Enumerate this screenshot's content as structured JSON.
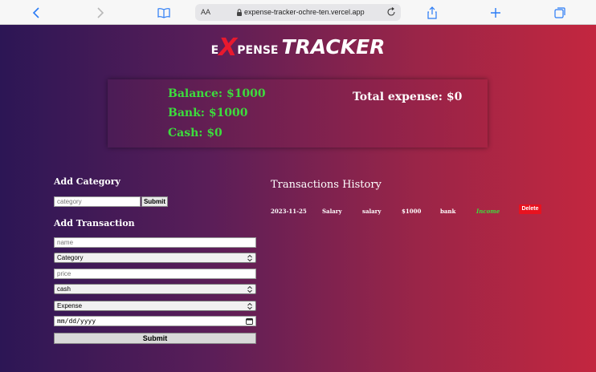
{
  "browser": {
    "text_size_label": "AA",
    "url": "expense-tracker-ochre-ten.vercel.app"
  },
  "title": {
    "first_letter": "E",
    "x_letter": "X",
    "rest": "PENSE",
    "tracker": "TRACKER"
  },
  "summary": {
    "balance": "Balance: $1000",
    "bank": "Bank: $1000",
    "cash": "Cash: $0",
    "total_expense": "Total expense: $0"
  },
  "add_category": {
    "heading": "Add Category",
    "placeholder": "category",
    "submit_label": "Submit"
  },
  "add_transaction": {
    "heading": "Add Transaction",
    "name_placeholder": "name",
    "category_selected": "Category",
    "price_placeholder": "price",
    "mode_selected": "cash",
    "type_selected": "Expense",
    "date_placeholder": "mm/dd/yyyy",
    "submit_label": "Submit"
  },
  "transactions": {
    "heading": "Transactions History",
    "rows": [
      {
        "date": "2023-11-25",
        "category": "Salary",
        "name": "salary",
        "amount": "$1000",
        "mode": "bank",
        "type": "Income",
        "delete_label": "Delete"
      }
    ]
  },
  "colors": {
    "positive": "#3ddc3d",
    "danger": "#e8121f",
    "gradient_start": "#2c1655",
    "gradient_end": "#c3263f"
  }
}
